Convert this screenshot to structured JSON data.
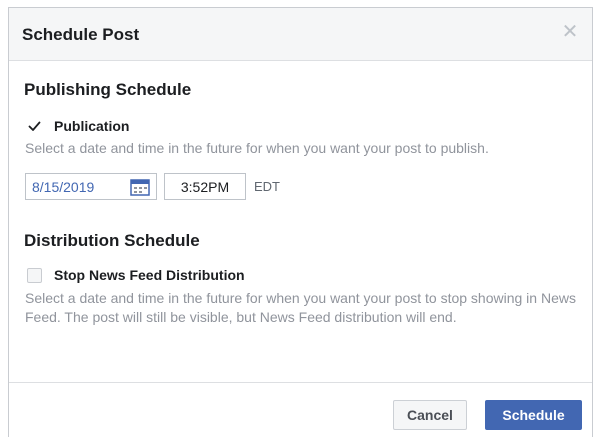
{
  "dialog": {
    "title": "Schedule Post",
    "close_icon": "close-icon"
  },
  "publishing": {
    "title": "Publishing Schedule",
    "checkbox_label": "Publication",
    "checked": true,
    "help": "Select a date and time in the future for when you want your post to publish.",
    "date_value": "8/15/2019",
    "time_value": "3:52PM",
    "timezone": "EDT",
    "calendar_icon": "calendar-icon"
  },
  "distribution": {
    "title": "Distribution Schedule",
    "checkbox_label": "Stop News Feed Distribution",
    "checked": false,
    "help": "Select a date and time in the future for when you want your post to stop showing in News Feed. The post will still be visible, but News Feed distribution will end."
  },
  "footer": {
    "cancel_label": "Cancel",
    "schedule_label": "Schedule"
  },
  "colors": {
    "accent": "#4267b2",
    "header_bg": "#f5f6f7",
    "muted_text": "#90949c"
  }
}
